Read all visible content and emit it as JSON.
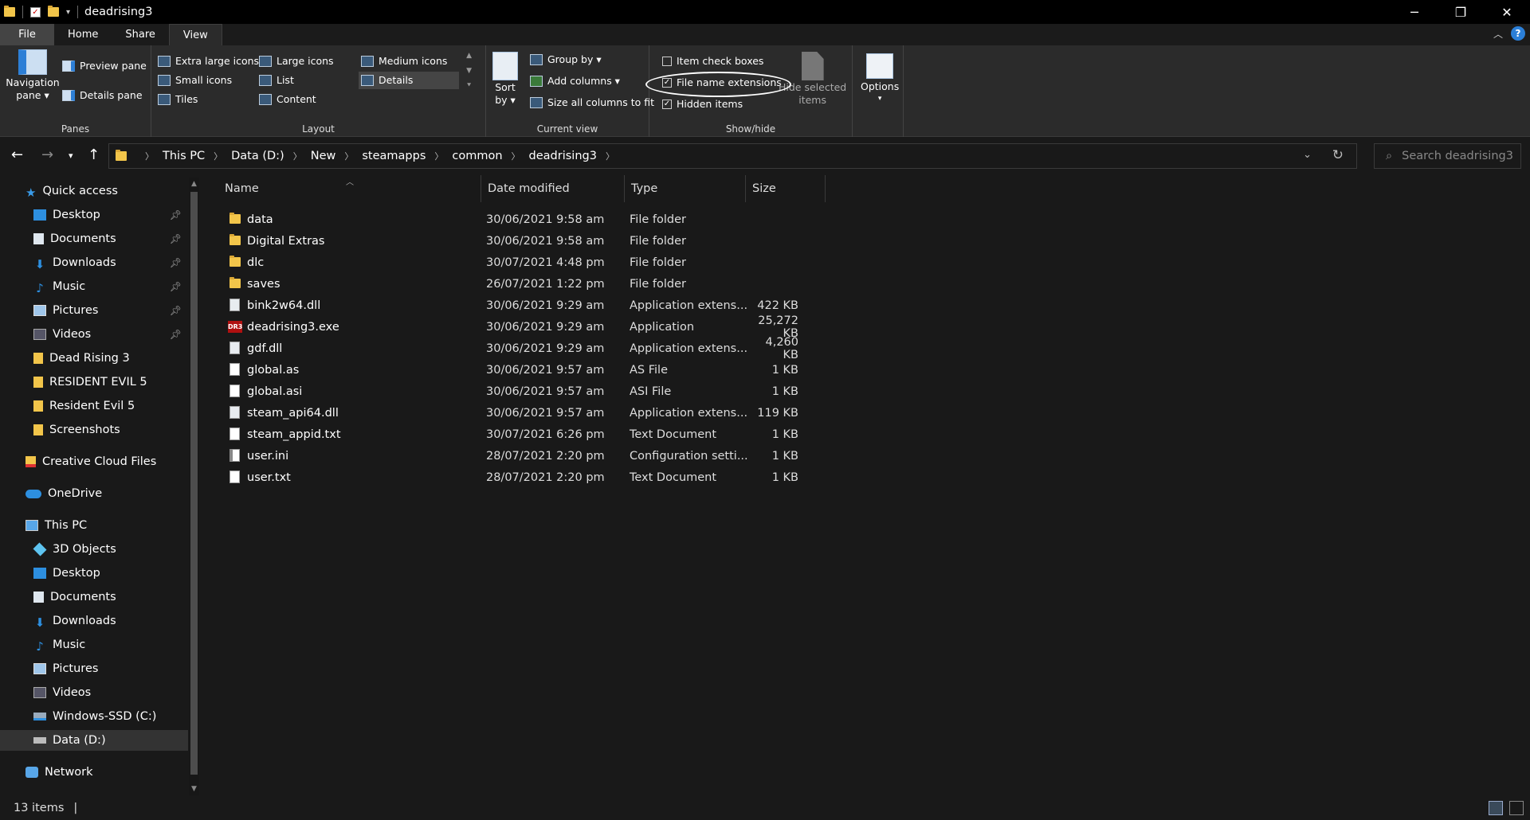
{
  "window": {
    "title": "deadrising3",
    "controls": {
      "minimize": "─",
      "restore": "❐",
      "close": "✕"
    }
  },
  "ribbon_tabs": [
    {
      "label": "File"
    },
    {
      "label": "Home"
    },
    {
      "label": "Share"
    },
    {
      "label": "View",
      "active": true
    }
  ],
  "ribbon": {
    "panes": {
      "label": "Panes",
      "navigation_pane": "Navigation\npane ▾",
      "nav_line1": "Navigation",
      "nav_line2": "pane ▾",
      "preview_pane": "Preview pane",
      "details_pane": "Details pane"
    },
    "layout": {
      "label": "Layout",
      "extra_large_icons": "Extra large icons",
      "large_icons": "Large icons",
      "medium_icons": "Medium icons",
      "small_icons": "Small icons",
      "list": "List",
      "details": "Details",
      "tiles": "Tiles",
      "content": "Content"
    },
    "current_view": {
      "label": "Current view",
      "sort_line1": "Sort",
      "sort_line2": "by ▾",
      "group_by": "Group by ▾",
      "add_columns": "Add columns ▾",
      "size_all_columns": "Size all columns to fit"
    },
    "show_hide": {
      "label": "Show/hide",
      "item_check_boxes": {
        "label": "Item check boxes",
        "checked": false
      },
      "file_name_extensions": {
        "label": "File name extensions",
        "checked": true
      },
      "hidden_items": {
        "label": "Hidden items",
        "checked": true
      },
      "hide_line1": "Hide selected",
      "hide_line2": "items"
    },
    "options": {
      "line1": "Options",
      "line2": "▾"
    }
  },
  "address": {
    "crumbs": [
      "This PC",
      "Data (D:)",
      "New",
      "steamapps",
      "common",
      "deadrising3"
    ],
    "search_placeholder": "Search deadrising3"
  },
  "sidebar": {
    "quick_access": "Quick access",
    "quick_items": [
      {
        "label": "Desktop",
        "icon": "desktop-icon",
        "pinned": true
      },
      {
        "label": "Documents",
        "icon": "documents-icon",
        "pinned": true
      },
      {
        "label": "Downloads",
        "icon": "downloads-icon",
        "pinned": true
      },
      {
        "label": "Music",
        "icon": "music-icon",
        "pinned": true
      },
      {
        "label": "Pictures",
        "icon": "pictures-icon",
        "pinned": true
      },
      {
        "label": "Videos",
        "icon": "videos-icon",
        "pinned": true
      },
      {
        "label": "Dead Rising 3",
        "icon": "folder-icon",
        "pinned": false
      },
      {
        "label": "RESIDENT EVIL 5",
        "icon": "folder-icon",
        "pinned": false
      },
      {
        "label": "Resident Evil 5",
        "icon": "folder-icon",
        "pinned": false
      },
      {
        "label": "Screenshots",
        "icon": "folder-icon",
        "pinned": false
      }
    ],
    "creative_cloud": "Creative Cloud Files",
    "onedrive": "OneDrive",
    "this_pc": "This PC",
    "pc_items": [
      {
        "label": "3D Objects",
        "icon": "3d-objects-icon"
      },
      {
        "label": "Desktop",
        "icon": "desktop-icon"
      },
      {
        "label": "Documents",
        "icon": "documents-icon"
      },
      {
        "label": "Downloads",
        "icon": "downloads-icon"
      },
      {
        "label": "Music",
        "icon": "music-icon"
      },
      {
        "label": "Pictures",
        "icon": "pictures-icon"
      },
      {
        "label": "Videos",
        "icon": "videos-icon"
      },
      {
        "label": "Windows-SSD (C:)",
        "icon": "drive-icon"
      },
      {
        "label": "Data (D:)",
        "icon": "drive-icon",
        "selected": true
      }
    ],
    "network": "Network"
  },
  "columns": {
    "name": "Name",
    "date": "Date modified",
    "type": "Type",
    "size": "Size"
  },
  "files": [
    {
      "name": "data",
      "date": "30/06/2021 9:58 am",
      "type": "File folder",
      "size": "",
      "icon": "folder-icon"
    },
    {
      "name": "Digital Extras",
      "date": "30/06/2021 9:58 am",
      "type": "File folder",
      "size": "",
      "icon": "folder-icon"
    },
    {
      "name": "dlc",
      "date": "30/07/2021 4:48 pm",
      "type": "File folder",
      "size": "",
      "icon": "folder-icon"
    },
    {
      "name": "saves",
      "date": "26/07/2021 1:22 pm",
      "type": "File folder",
      "size": "",
      "icon": "folder-icon"
    },
    {
      "name": "bink2w64.dll",
      "date": "30/06/2021 9:29 am",
      "type": "Application extens...",
      "size": "422 KB",
      "icon": "dll-icon"
    },
    {
      "name": "deadrising3.exe",
      "date": "30/06/2021 9:29 am",
      "type": "Application",
      "size": "25,272 KB",
      "icon": "exe-icon"
    },
    {
      "name": "gdf.dll",
      "date": "30/06/2021 9:29 am",
      "type": "Application extens...",
      "size": "4,260 KB",
      "icon": "dll-icon"
    },
    {
      "name": "global.as",
      "date": "30/06/2021 9:57 am",
      "type": "AS File",
      "size": "1 KB",
      "icon": "file-icon"
    },
    {
      "name": "global.asi",
      "date": "30/06/2021 9:57 am",
      "type": "ASI File",
      "size": "1 KB",
      "icon": "file-icon"
    },
    {
      "name": "steam_api64.dll",
      "date": "30/06/2021 9:57 am",
      "type": "Application extens...",
      "size": "119 KB",
      "icon": "dll-icon"
    },
    {
      "name": "steam_appid.txt",
      "date": "30/07/2021 6:26 pm",
      "type": "Text Document",
      "size": "1 KB",
      "icon": "text-file-icon"
    },
    {
      "name": "user.ini",
      "date": "28/07/2021 2:20 pm",
      "type": "Configuration setti...",
      "size": "1 KB",
      "icon": "config-file-icon"
    },
    {
      "name": "user.txt",
      "date": "28/07/2021 2:20 pm",
      "type": "Text Document",
      "size": "1 KB",
      "icon": "text-file-icon"
    }
  ],
  "status": {
    "items": "13 items",
    "divider": "|"
  }
}
